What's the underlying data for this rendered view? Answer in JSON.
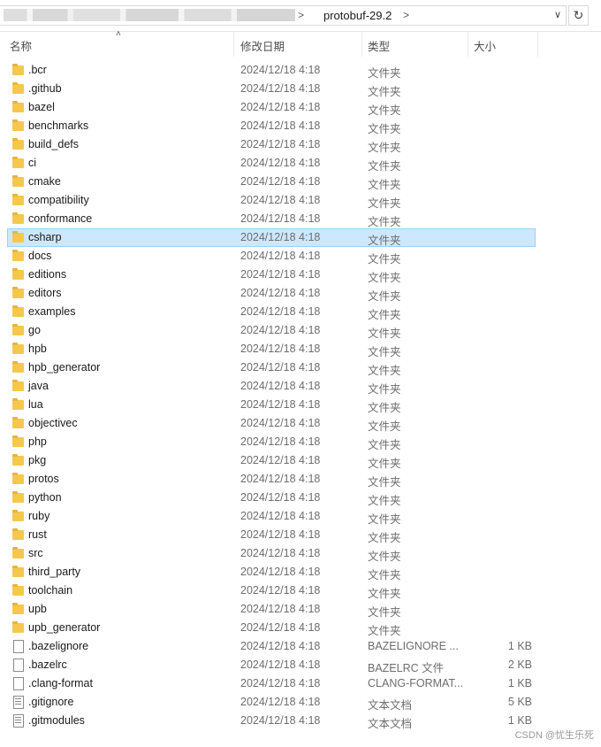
{
  "address": {
    "current_folder": "protobuf-29.2",
    "separator": ">"
  },
  "columns": {
    "name": "名称",
    "date": "修改日期",
    "type": "类型",
    "size": "大小"
  },
  "files": [
    {
      "name": ".bcr",
      "date": "2024/12/18 4:18",
      "type": "文件夹",
      "size": "",
      "icon": "folder-icon"
    },
    {
      "name": ".github",
      "date": "2024/12/18 4:18",
      "type": "文件夹",
      "size": "",
      "icon": "folder-icon"
    },
    {
      "name": "bazel",
      "date": "2024/12/18 4:18",
      "type": "文件夹",
      "size": "",
      "icon": "folder-icon"
    },
    {
      "name": "benchmarks",
      "date": "2024/12/18 4:18",
      "type": "文件夹",
      "size": "",
      "icon": "folder-icon"
    },
    {
      "name": "build_defs",
      "date": "2024/12/18 4:18",
      "type": "文件夹",
      "size": "",
      "icon": "folder-icon"
    },
    {
      "name": "ci",
      "date": "2024/12/18 4:18",
      "type": "文件夹",
      "size": "",
      "icon": "folder-icon"
    },
    {
      "name": "cmake",
      "date": "2024/12/18 4:18",
      "type": "文件夹",
      "size": "",
      "icon": "folder-icon"
    },
    {
      "name": "compatibility",
      "date": "2024/12/18 4:18",
      "type": "文件夹",
      "size": "",
      "icon": "folder-icon"
    },
    {
      "name": "conformance",
      "date": "2024/12/18 4:18",
      "type": "文件夹",
      "size": "",
      "icon": "folder-icon"
    },
    {
      "name": "csharp",
      "date": "2024/12/18 4:18",
      "type": "文件夹",
      "size": "",
      "icon": "folder-icon",
      "selected": true
    },
    {
      "name": "docs",
      "date": "2024/12/18 4:18",
      "type": "文件夹",
      "size": "",
      "icon": "folder-icon"
    },
    {
      "name": "editions",
      "date": "2024/12/18 4:18",
      "type": "文件夹",
      "size": "",
      "icon": "folder-icon"
    },
    {
      "name": "editors",
      "date": "2024/12/18 4:18",
      "type": "文件夹",
      "size": "",
      "icon": "folder-icon"
    },
    {
      "name": "examples",
      "date": "2024/12/18 4:18",
      "type": "文件夹",
      "size": "",
      "icon": "folder-icon"
    },
    {
      "name": "go",
      "date": "2024/12/18 4:18",
      "type": "文件夹",
      "size": "",
      "icon": "folder-icon"
    },
    {
      "name": "hpb",
      "date": "2024/12/18 4:18",
      "type": "文件夹",
      "size": "",
      "icon": "folder-icon"
    },
    {
      "name": "hpb_generator",
      "date": "2024/12/18 4:18",
      "type": "文件夹",
      "size": "",
      "icon": "folder-icon"
    },
    {
      "name": "java",
      "date": "2024/12/18 4:18",
      "type": "文件夹",
      "size": "",
      "icon": "folder-icon"
    },
    {
      "name": "lua",
      "date": "2024/12/18 4:18",
      "type": "文件夹",
      "size": "",
      "icon": "folder-icon"
    },
    {
      "name": "objectivec",
      "date": "2024/12/18 4:18",
      "type": "文件夹",
      "size": "",
      "icon": "folder-icon"
    },
    {
      "name": "php",
      "date": "2024/12/18 4:18",
      "type": "文件夹",
      "size": "",
      "icon": "folder-icon"
    },
    {
      "name": "pkg",
      "date": "2024/12/18 4:18",
      "type": "文件夹",
      "size": "",
      "icon": "folder-icon"
    },
    {
      "name": "protos",
      "date": "2024/12/18 4:18",
      "type": "文件夹",
      "size": "",
      "icon": "folder-icon"
    },
    {
      "name": "python",
      "date": "2024/12/18 4:18",
      "type": "文件夹",
      "size": "",
      "icon": "folder-icon"
    },
    {
      "name": "ruby",
      "date": "2024/12/18 4:18",
      "type": "文件夹",
      "size": "",
      "icon": "folder-icon"
    },
    {
      "name": "rust",
      "date": "2024/12/18 4:18",
      "type": "文件夹",
      "size": "",
      "icon": "folder-icon"
    },
    {
      "name": "src",
      "date": "2024/12/18 4:18",
      "type": "文件夹",
      "size": "",
      "icon": "folder-icon"
    },
    {
      "name": "third_party",
      "date": "2024/12/18 4:18",
      "type": "文件夹",
      "size": "",
      "icon": "folder-icon"
    },
    {
      "name": "toolchain",
      "date": "2024/12/18 4:18",
      "type": "文件夹",
      "size": "",
      "icon": "folder-icon"
    },
    {
      "name": "upb",
      "date": "2024/12/18 4:18",
      "type": "文件夹",
      "size": "",
      "icon": "folder-icon"
    },
    {
      "name": "upb_generator",
      "date": "2024/12/18 4:18",
      "type": "文件夹",
      "size": "",
      "icon": "folder-icon"
    },
    {
      "name": ".bazelignore",
      "date": "2024/12/18 4:18",
      "type": "BAZELIGNORE ...",
      "size": "1 KB",
      "icon": "file-icon"
    },
    {
      "name": ".bazelrc",
      "date": "2024/12/18 4:18",
      "type": "BAZELRC 文件",
      "size": "2 KB",
      "icon": "file-icon"
    },
    {
      "name": ".clang-format",
      "date": "2024/12/18 4:18",
      "type": "CLANG-FORMAT...",
      "size": "1 KB",
      "icon": "file-icon"
    },
    {
      "name": ".gitignore",
      "date": "2024/12/18 4:18",
      "type": "文本文档",
      "size": "5 KB",
      "icon": "text-file-icon"
    },
    {
      "name": ".gitmodules",
      "date": "2024/12/18 4:18",
      "type": "文本文档",
      "size": "1 KB",
      "icon": "text-file-icon"
    }
  ],
  "watermark": "CSDN @忧生乐死",
  "colors": {
    "selection_bg": "#cce8ff",
    "selection_border": "#99d1ff",
    "folder": "#f5c84c"
  }
}
